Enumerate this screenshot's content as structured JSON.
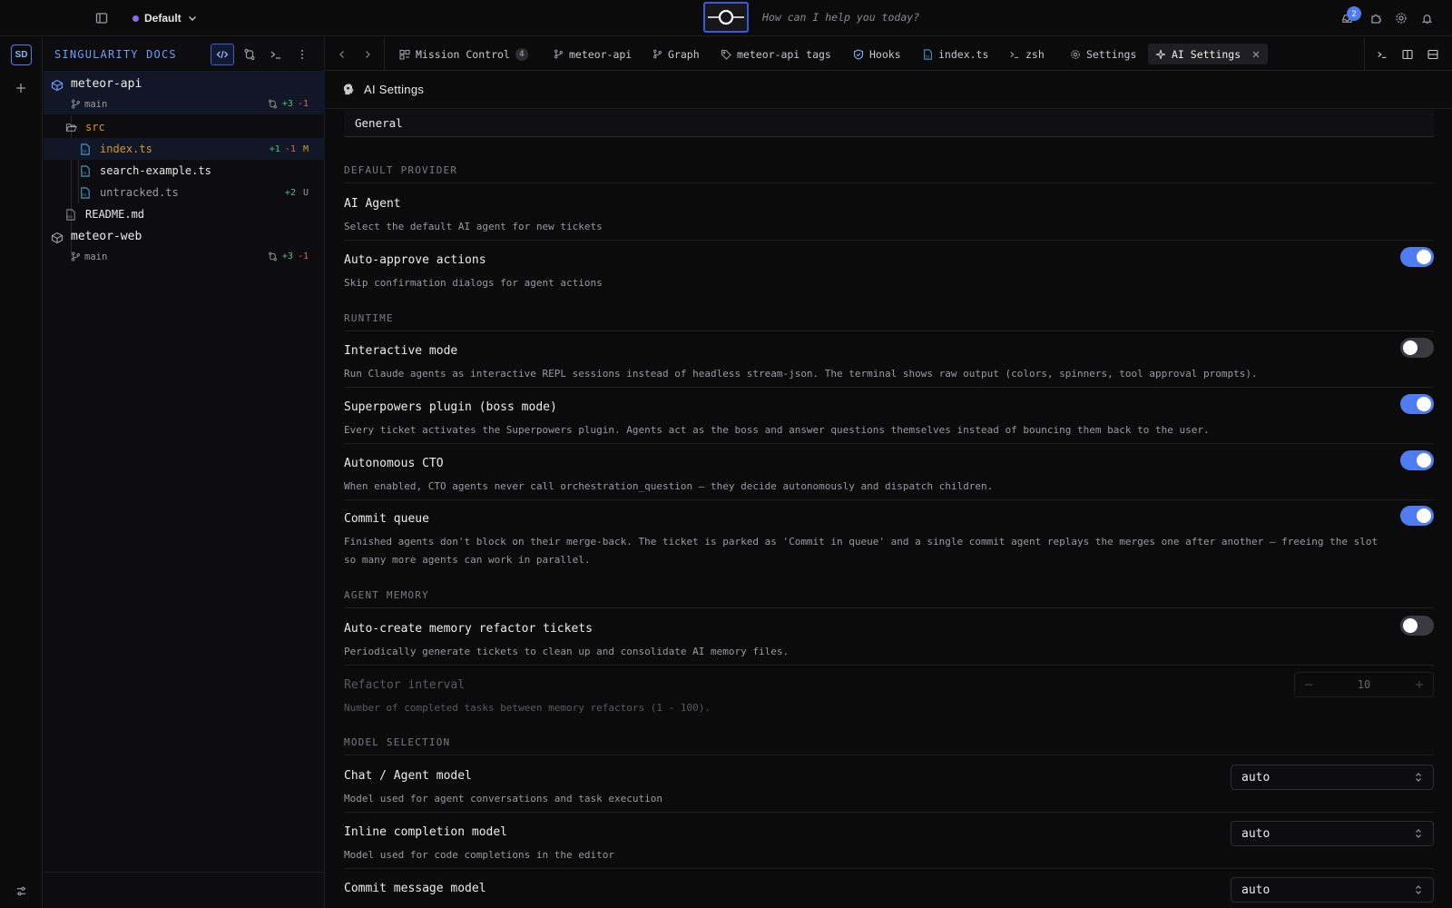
{
  "topbar": {
    "workspace": "Default",
    "omnibox_placeholder": "How can I help you today?",
    "notifications_count": "2"
  },
  "rail": {
    "avatar": "SD"
  },
  "sidebar": {
    "title": "SINGULARITY DOCS",
    "repos": [
      {
        "name": "meteor-api",
        "branch": "main",
        "plus": "+3",
        "minus": "-1"
      },
      {
        "name": "meteor-web",
        "branch": "main",
        "plus": "+3",
        "minus": "-1"
      }
    ],
    "folder": "src",
    "files": [
      {
        "name": "index.ts",
        "plus": "+1",
        "minus": "-1",
        "status": "M"
      },
      {
        "name": "search-example.ts"
      },
      {
        "name": "untracked.ts",
        "plus": "+2",
        "status": "U"
      }
    ],
    "readme": "README.md"
  },
  "tabs": [
    {
      "label": "Mission Control",
      "count": "4",
      "icon": "grid-icon"
    },
    {
      "label": "meteor-api",
      "icon": "branch-icon"
    },
    {
      "label": "Graph",
      "icon": "branch-icon"
    },
    {
      "label": "meteor-api tags",
      "icon": "tag-icon"
    },
    {
      "label": "Hooks",
      "icon": "shield-icon"
    },
    {
      "label": "index.ts",
      "icon": "file-icon"
    },
    {
      "label": "zsh",
      "icon": "terminal-icon"
    },
    {
      "label": "Settings",
      "icon": "gear-icon"
    },
    {
      "label": "AI Settings",
      "icon": "sparkle-icon",
      "active": true
    }
  ],
  "page": {
    "title": "AI Settings",
    "tab": "General"
  },
  "sections": {
    "default_provider": "DEFAULT PROVIDER",
    "runtime": "RUNTIME",
    "agent_memory": "AGENT MEMORY",
    "model_selection": "MODEL SELECTION"
  },
  "settings": {
    "ai_agent": {
      "title": "AI Agent",
      "desc": "Select the default AI agent for new tickets"
    },
    "auto_approve": {
      "title": "Auto-approve actions",
      "desc": "Skip confirmation dialogs for agent actions",
      "enabled": true
    },
    "interactive": {
      "title": "Interactive mode",
      "desc": "Run Claude agents as interactive REPL sessions instead of headless stream-json. The terminal shows raw output (colors, spinners, tool approval prompts).",
      "enabled": false
    },
    "superpowers": {
      "title": "Superpowers plugin (boss mode)",
      "desc": "Every ticket activates the Superpowers plugin. Agents act as the boss and answer questions themselves instead of bouncing them back to the user.",
      "enabled": true
    },
    "cto": {
      "title": "Autonomous CTO",
      "desc": "When enabled, CTO agents never call orchestration_question — they decide autonomously and dispatch children.",
      "enabled": true
    },
    "commit_queue": {
      "title": "Commit queue",
      "desc": "Finished agents don't block on their merge-back. The ticket is parked as 'Commit in queue' and a single commit agent replays the merges one after another — freeing the slot so many more agents can work in parallel.",
      "enabled": true
    },
    "memory_refactor": {
      "title": "Auto-create memory refactor tickets",
      "desc": "Periodically generate tickets to clean up and consolidate AI memory files.",
      "enabled": false
    },
    "refactor_interval": {
      "title": "Refactor interval",
      "desc": "Number of completed tasks between memory refactors (1 - 100).",
      "value": "10"
    },
    "chat_model": {
      "title": "Chat / Agent model",
      "desc": "Model used for agent conversations and task execution",
      "value": "auto"
    },
    "inline_model": {
      "title": "Inline completion model",
      "desc": "Model used for code completions in the editor",
      "value": "auto"
    },
    "commit_model": {
      "title": "Commit message model",
      "value": "auto"
    }
  },
  "colors": {
    "accent": "#4f7cf0",
    "added": "#4ec27c",
    "removed": "#e06464",
    "modified": "#d29922"
  }
}
